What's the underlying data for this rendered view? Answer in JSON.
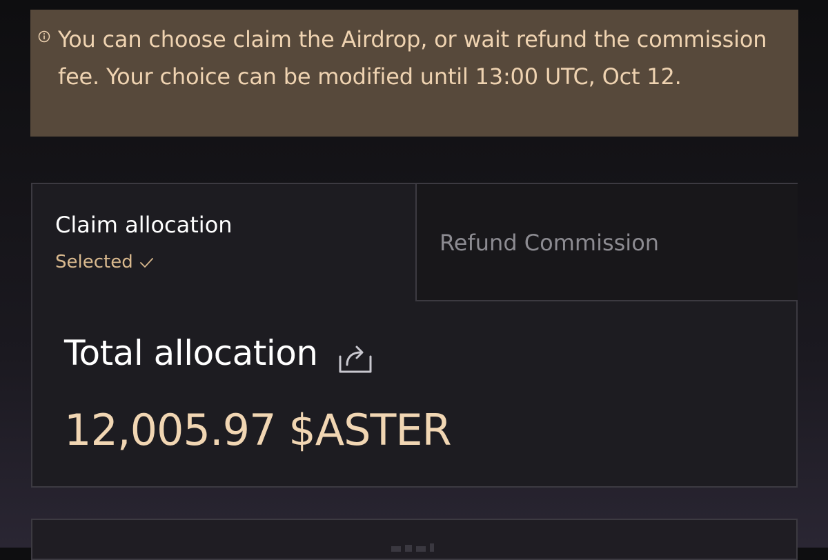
{
  "notice": {
    "icon": "info-icon",
    "text": "You can choose claim the Airdrop, or wait refund the commission fee. Your choice can be modified until 13:00 UTC, Oct 12."
  },
  "tabs": {
    "claim": {
      "title": "Claim allocation",
      "status": "Selected",
      "status_icon": "check-icon",
      "selected": true
    },
    "refund": {
      "label": "Refund Commission",
      "selected": false
    }
  },
  "allocation": {
    "title": "Total allocation",
    "share_icon": "share-icon",
    "value": "12,005.97 $ASTER"
  },
  "colors": {
    "accent": "#efd3b1",
    "notice_bg": "#57493b",
    "panel_bg": "#1d1c21",
    "border": "#3c3a41",
    "muted_text": "#8c8b91"
  }
}
